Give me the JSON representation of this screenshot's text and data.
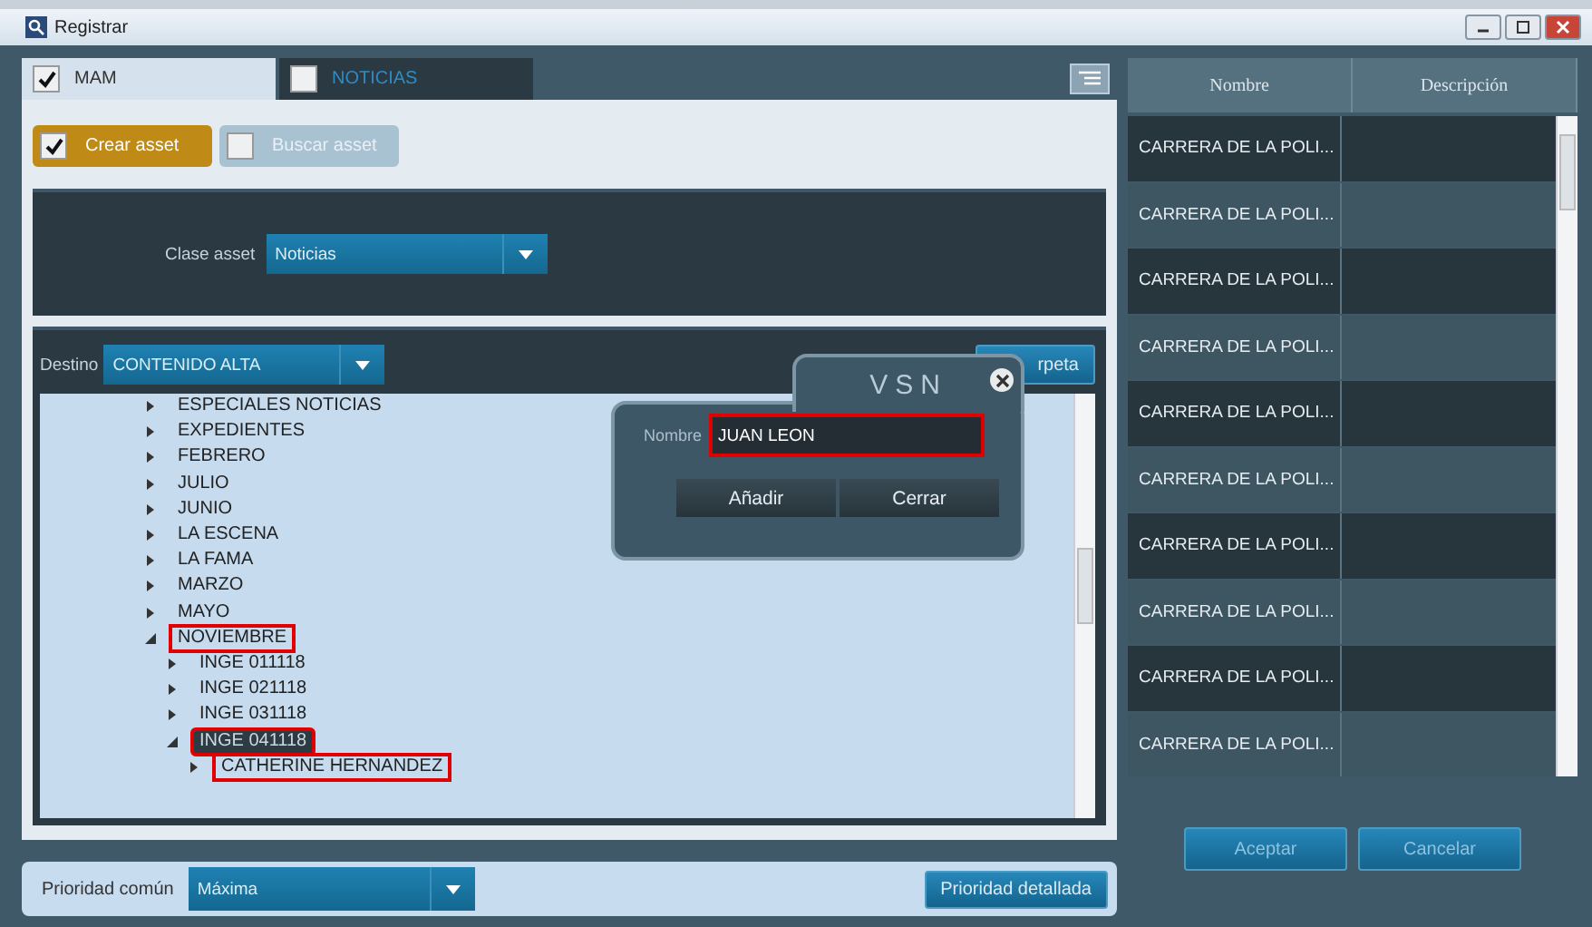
{
  "window": {
    "title": "Registrar"
  },
  "tabs": [
    {
      "label": "MAM",
      "selected": true
    },
    {
      "label": "NOTICIAS",
      "selected": false
    }
  ],
  "mode_toggles": [
    {
      "label": "Crear asset",
      "checked": true
    },
    {
      "label": "Buscar asset",
      "checked": false
    }
  ],
  "clase_asset": {
    "label": "Clase asset",
    "value": "Noticias"
  },
  "destino": {
    "label": "Destino",
    "value": "CONTENIDO ALTA"
  },
  "folder_button": "rpeta",
  "tree": [
    {
      "label": "ESPECIALES NOTICIAS",
      "expanded": false,
      "selected": false,
      "highlighted": false
    },
    {
      "label": "EXPEDIENTES",
      "expanded": false,
      "selected": false,
      "highlighted": false
    },
    {
      "label": "FEBRERO",
      "expanded": false,
      "selected": false,
      "highlighted": false
    },
    {
      "label": "JULIO",
      "expanded": false,
      "selected": false,
      "highlighted": false
    },
    {
      "label": "JUNIO",
      "expanded": false,
      "selected": false,
      "highlighted": false
    },
    {
      "label": "LA ESCENA",
      "expanded": false,
      "selected": false,
      "highlighted": false
    },
    {
      "label": "LA FAMA",
      "expanded": false,
      "selected": false,
      "highlighted": false
    },
    {
      "label": "MARZO",
      "expanded": false,
      "selected": false,
      "highlighted": false
    },
    {
      "label": "MAYO",
      "expanded": false,
      "selected": false,
      "highlighted": false
    },
    {
      "label": "NOVIEMBRE",
      "expanded": true,
      "selected": false,
      "highlighted": true,
      "children": [
        {
          "label": "INGE 011118",
          "expanded": false,
          "selected": false,
          "highlighted": false
        },
        {
          "label": "INGE 021118",
          "expanded": false,
          "selected": false,
          "highlighted": false
        },
        {
          "label": "INGE 031118",
          "expanded": false,
          "selected": false,
          "highlighted": false
        },
        {
          "label": "INGE 041118",
          "expanded": true,
          "selected": true,
          "highlighted": true,
          "children": [
            {
              "label": "CATHERINE HERNANDEZ",
              "expanded": false,
              "selected": false,
              "highlighted": true
            }
          ]
        }
      ]
    }
  ],
  "dialog": {
    "logo": "VSN",
    "field_label": "Nombre",
    "field_value": "JUAN LEON",
    "field_highlighted": true,
    "buttons": [
      "Añadir",
      "Cerrar"
    ]
  },
  "priority": {
    "label": "Prioridad común",
    "value": "Máxima",
    "button": "Prioridad detallada"
  },
  "table": {
    "columns": [
      "Nombre",
      "Descripción"
    ],
    "rows": [
      {
        "name": "CARRERA DE LA POLI..."
      },
      {
        "name": "CARRERA DE LA POLI..."
      },
      {
        "name": "CARRERA DE LA POLI..."
      },
      {
        "name": "CARRERA DE LA POLI..."
      },
      {
        "name": "CARRERA DE LA POLI..."
      },
      {
        "name": "CARRERA DE LA POLI..."
      },
      {
        "name": "CARRERA DE LA POLI..."
      },
      {
        "name": "CARRERA DE LA POLI..."
      },
      {
        "name": "CARRERA DE LA POLI..."
      },
      {
        "name": "CARRERA DE LA POLI..."
      }
    ]
  },
  "buttons": [
    "Aceptar",
    "Cancelar"
  ]
}
